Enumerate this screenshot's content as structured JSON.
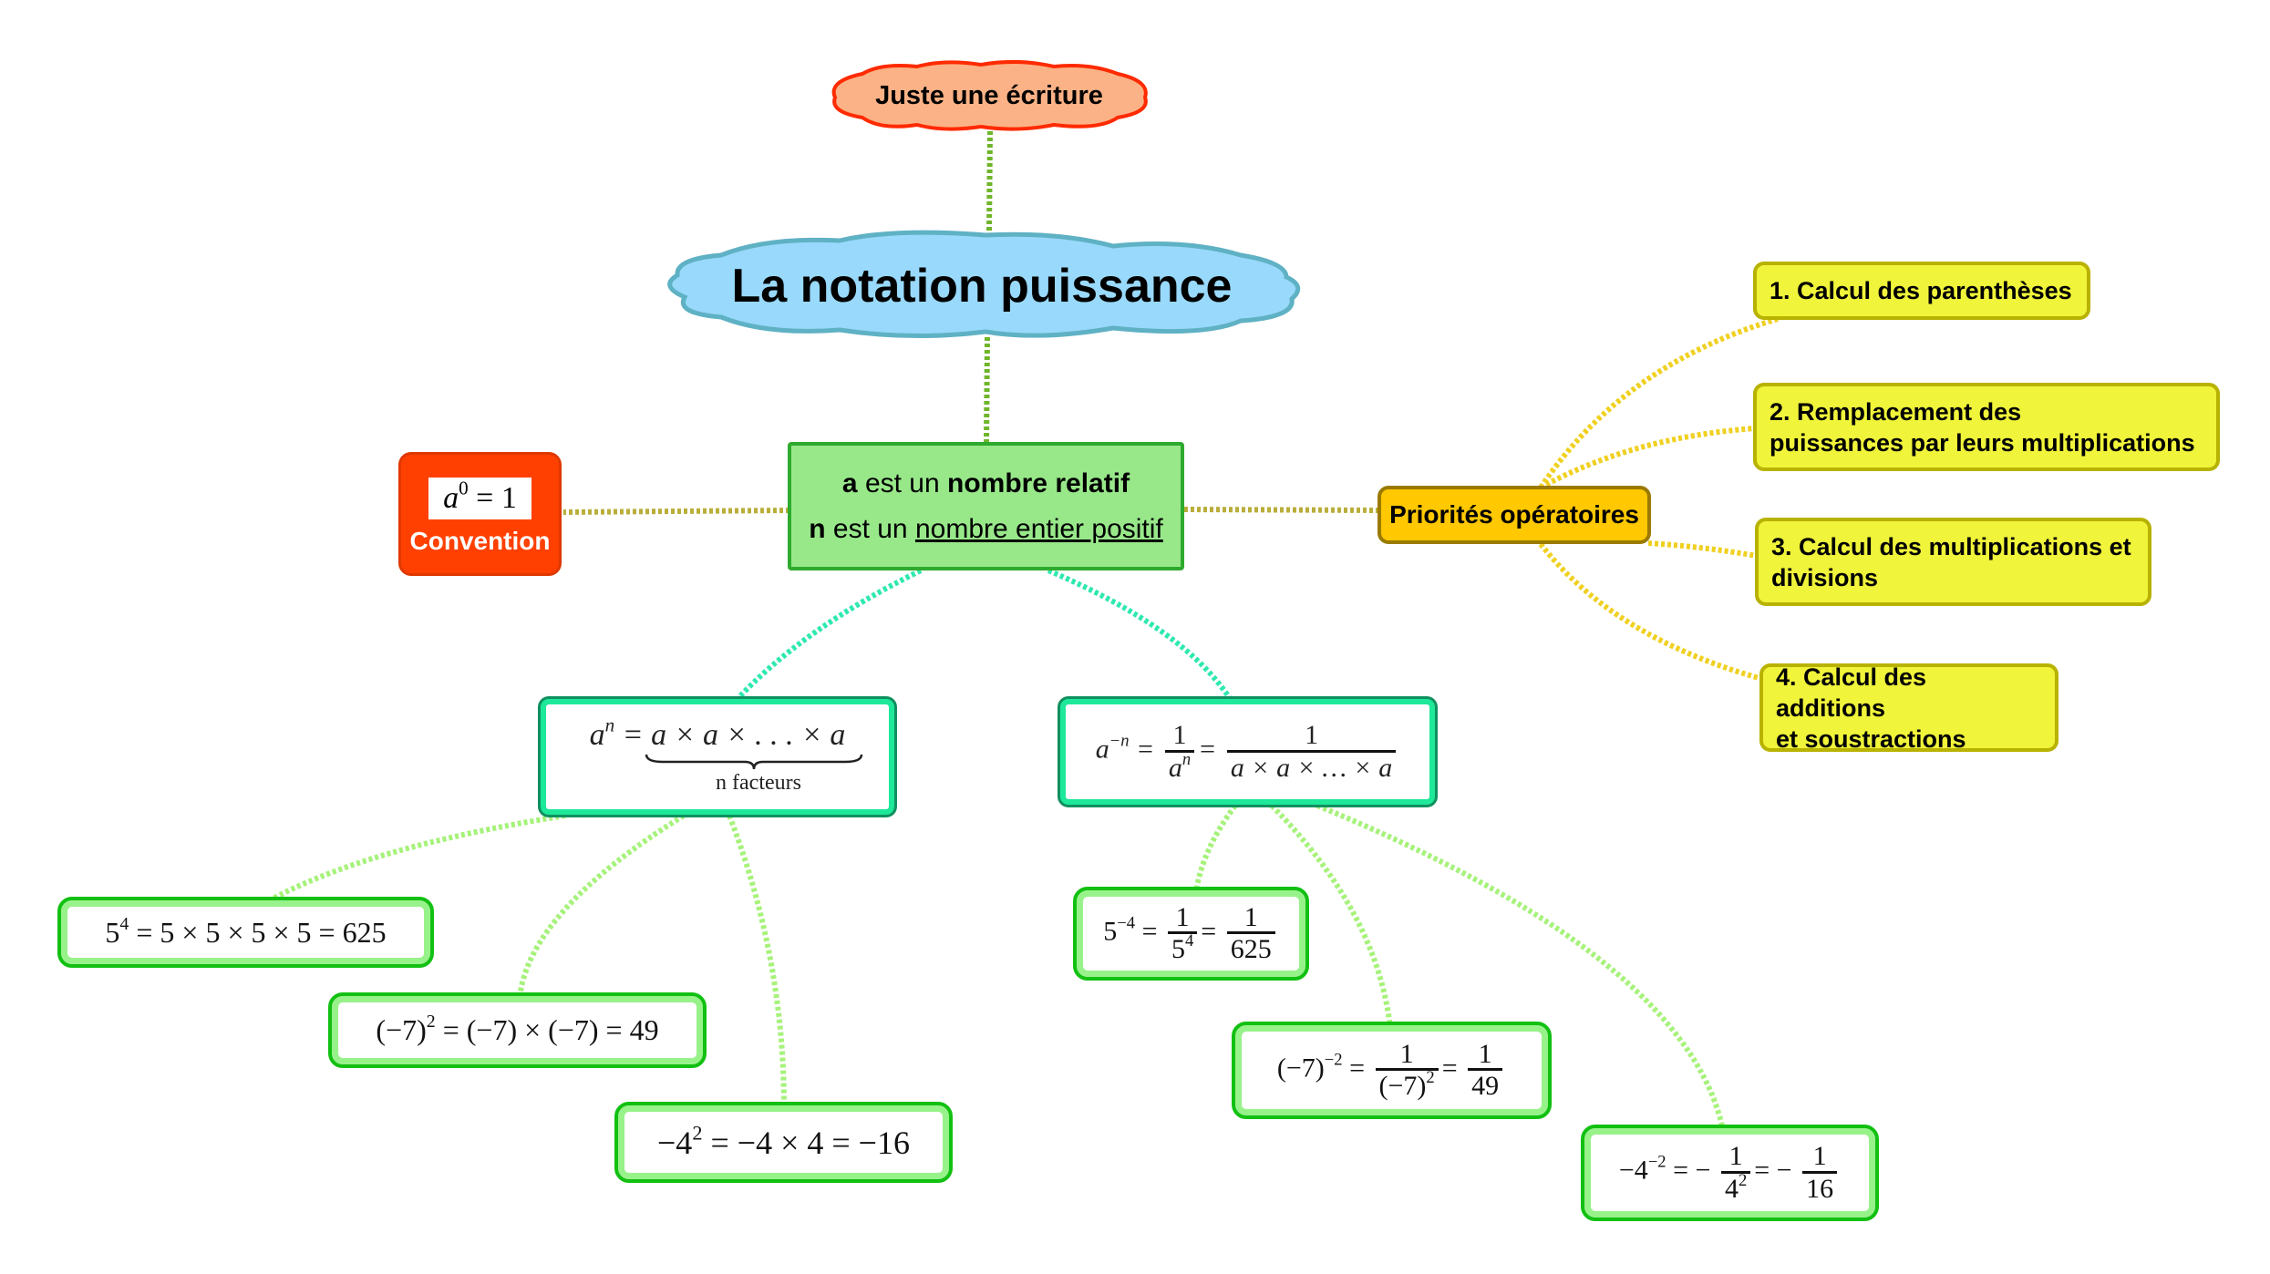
{
  "title": "La notation puissance",
  "top_note": "Juste une écriture",
  "center": {
    "line1_var": "a",
    "line1_mid": " est un ",
    "line1_bold": "nombre relatif",
    "line2_var": "n",
    "line2_mid": " est un ",
    "line2_underlined": "nombre entier positif"
  },
  "convention": {
    "formula_base": "a",
    "formula_exp": "0",
    "formula_rest": " = 1",
    "caption": "Convention"
  },
  "priorities": {
    "title": "Priorités opératoires",
    "steps": [
      {
        "line1": "1. Calcul des parenthèses",
        "line2": ""
      },
      {
        "line1": "2. Remplacement des",
        "line2": "puissances par leurs multiplications"
      },
      {
        "line1": "3. Calcul des multiplications et",
        "line2": "divisions"
      },
      {
        "line1": "4. Calcul des additions",
        "line2": "et soustractions"
      }
    ]
  },
  "positive_power": {
    "lhs_base": "a",
    "lhs_exp": "n",
    "rhs": "= a × a × . . . × a",
    "brace_label": "n facteurs",
    "examples": [
      {
        "base": "5",
        "exp": "4",
        "rest": " = 5 × 5 × 5 × 5 = 625"
      },
      {
        "base": "(−7)",
        "exp": "2",
        "rest": " = (−7) × (−7) = 49"
      },
      {
        "base": "−4",
        "exp": "2",
        "rest": " = −4 × 4 = −16"
      }
    ]
  },
  "negative_power": {
    "lhs_base": "a",
    "lhs_exp": "−n",
    "frac1_num": "1",
    "frac1_den_base": "a",
    "frac1_den_exp": "n",
    "frac2_num": "1",
    "frac2_den": "a × a × … × a",
    "examples": [
      {
        "base": "5",
        "exp": "−4",
        "f1_num": "1",
        "f1_den_base": "5",
        "f1_den_exp": "4",
        "sign": "",
        "f2_num": "1",
        "f2_den": "625"
      },
      {
        "base": "(−7)",
        "exp": "−2",
        "f1_num": "1",
        "f1_den_base": "(−7)",
        "f1_den_exp": "2",
        "sign": "",
        "f2_num": "1",
        "f2_den": "49"
      },
      {
        "base": "−4",
        "exp": "−2",
        "f1_num": "1",
        "f1_den_base": "4",
        "f1_den_exp": "2",
        "sign": "−",
        "f2_num": "1",
        "f2_den": "16"
      }
    ]
  },
  "colors": {
    "title_cloud_fill": "#99d9fb",
    "title_cloud_stroke": "#5fb1c4",
    "note_cloud_fill": "#fbb286",
    "note_cloud_stroke": "#ff2a00",
    "center_fill": "#98e88a",
    "convention_fill": "#ff4000",
    "priority_fill": "#ffc800",
    "step_fill": "#f0f43a",
    "definition_border": "#1ee89a",
    "example_border": "#12c012"
  }
}
